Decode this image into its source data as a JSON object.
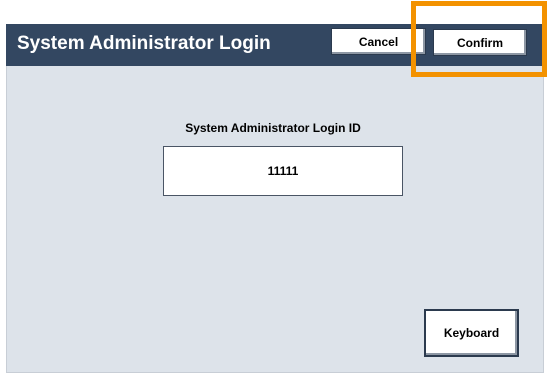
{
  "header": {
    "title": "System Administrator Login",
    "cancel_label": "Cancel",
    "confirm_label": "Confirm"
  },
  "login": {
    "field_label": "System Administrator Login ID",
    "id_value": "11111"
  },
  "keyboard": {
    "label": "Keyboard"
  },
  "colors": {
    "header_bg": "#334761",
    "panel_bg": "#dde3ea",
    "highlight": "#f39200"
  }
}
